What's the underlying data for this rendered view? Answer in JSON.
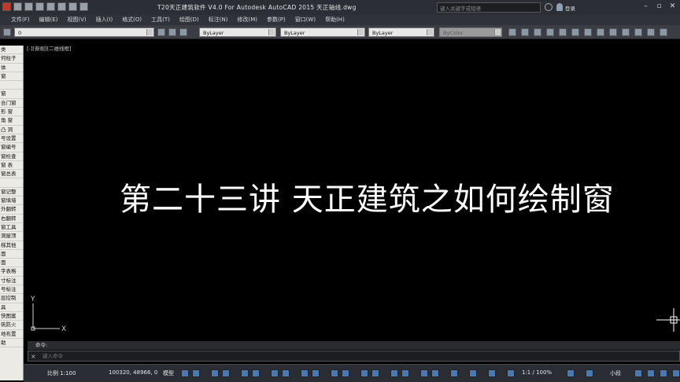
{
  "app": {
    "title": "T20天正建筑软件 V4.0 For Autodesk AutoCAD 2015    天正轴线.dwg",
    "search_placeholder": "键入关键字或短语",
    "login_label": "登录"
  },
  "menu": [
    "文件(F)",
    "编辑(E)",
    "视图(V)",
    "插入(I)",
    "格式(O)",
    "工具(T)",
    "绘图(D)",
    "标注(N)",
    "修改(M)",
    "参数(P)",
    "窗口(W)",
    "帮助(H)"
  ],
  "toolbar": {
    "layer_value": "0",
    "color_value": "ByLayer",
    "linetype_value": "ByLayer",
    "lineweight_value": "ByLayer",
    "plotstyle_value": "ByColor"
  },
  "palette": {
    "items": [
      "类",
      "何柱子",
      "体",
      "窗",
      "",
      "窗",
      "合门窗",
      "形 窗",
      "角 窗",
      "凸 洞",
      "号设置",
      "窗编号",
      "窗检查",
      "窗 表",
      "窗总表",
      "",
      "窗记整",
      "窗填墙",
      "外翻转",
      "右翻转",
      "窗工具",
      "洞屋顶",
      "梯其他",
      "面",
      "面",
      "字表格",
      "寸标注",
      "号标注",
      "层控制",
      "具",
      "快图案",
      "筑防火",
      "地布置",
      "助"
    ]
  },
  "drawing": {
    "viewport_label": "[-][俯视][二维线框]",
    "headline": "第二十三讲 天正建筑之如何绘制窗",
    "ucs_x": "X",
    "ucs_y": "Y"
  },
  "command": {
    "history": "命令:",
    "placeholder": "键入命令",
    "close_glyph": "×"
  },
  "status": {
    "scale": "比例 1:100",
    "coords": "100320, 48966, 0",
    "model": "模型",
    "annotation_scale": "1:1 / 100%",
    "workspace": "小段"
  },
  "icons": {
    "window_controls": [
      "minimize-icon",
      "restore-icon",
      "close-icon"
    ],
    "command_close": "close-icon"
  }
}
